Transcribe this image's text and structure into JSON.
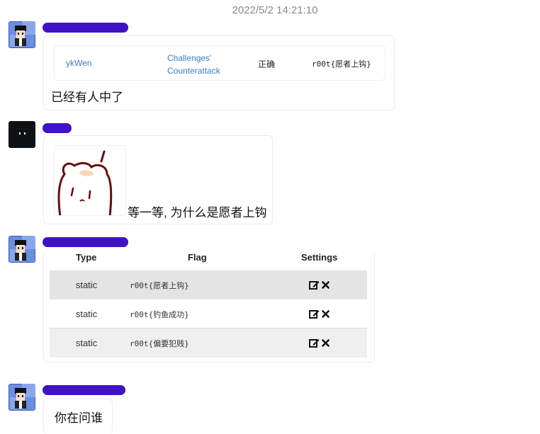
{
  "timestamp": "2022/5/2 14:21:10",
  "messages": [
    {
      "card": {
        "user": "ykWen",
        "challenge_line1": "Challenges'",
        "challenge_line2": "Counterattack",
        "status": "正确",
        "flag": "r00t{愿者上钩}"
      },
      "text": "已经有人中了"
    },
    {
      "text": "等一等, 为什么是愿者上钩"
    },
    {
      "table": {
        "headers": [
          "Type",
          "Flag",
          "Settings"
        ],
        "rows": [
          {
            "type": "static",
            "flag": "r00t{愿者上钩}"
          },
          {
            "type": "static",
            "flag": "r00t{钓鱼成功}"
          },
          {
            "type": "static",
            "flag": "r00t{偏要犯贱}"
          }
        ]
      }
    },
    {
      "text": "你在问谁"
    }
  ],
  "colors": {
    "namebar": "#3f12c4",
    "link": "#3c7fc4",
    "row_shade": "#e4e4e4"
  }
}
